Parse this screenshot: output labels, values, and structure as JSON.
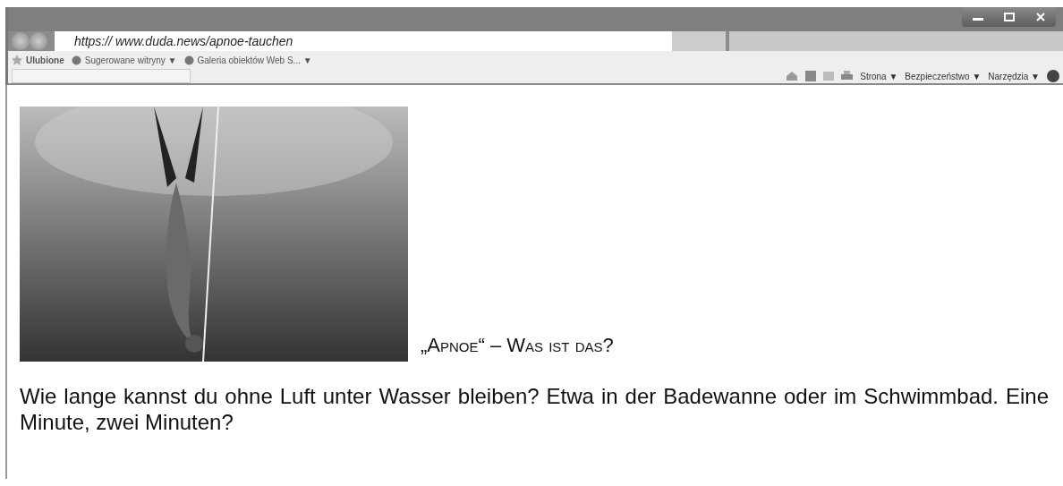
{
  "browser": {
    "address": "https:// www.duda.news/apnoe-tauchen",
    "favorites": [
      {
        "label": "Ulubione",
        "kind": "favorites"
      },
      {
        "label": "Sugerowane witryny ▼",
        "kind": "site"
      },
      {
        "label": "Galeria obiektów Web S... ▼",
        "kind": "site"
      }
    ],
    "commands": [
      {
        "label": "Strona ▼"
      },
      {
        "label": "Bezpieczeństwo ▼"
      },
      {
        "label": "Narzędzia ▼"
      }
    ]
  },
  "article": {
    "heading": "„Apnoe“ – Was ist das?",
    "paragraph": "Wie lange kannst du ohne Luft unter Wasser bleiben? Etwa in der Badewanne oder im Schwimmbad. Eine Minute, zwei Minuten?"
  }
}
